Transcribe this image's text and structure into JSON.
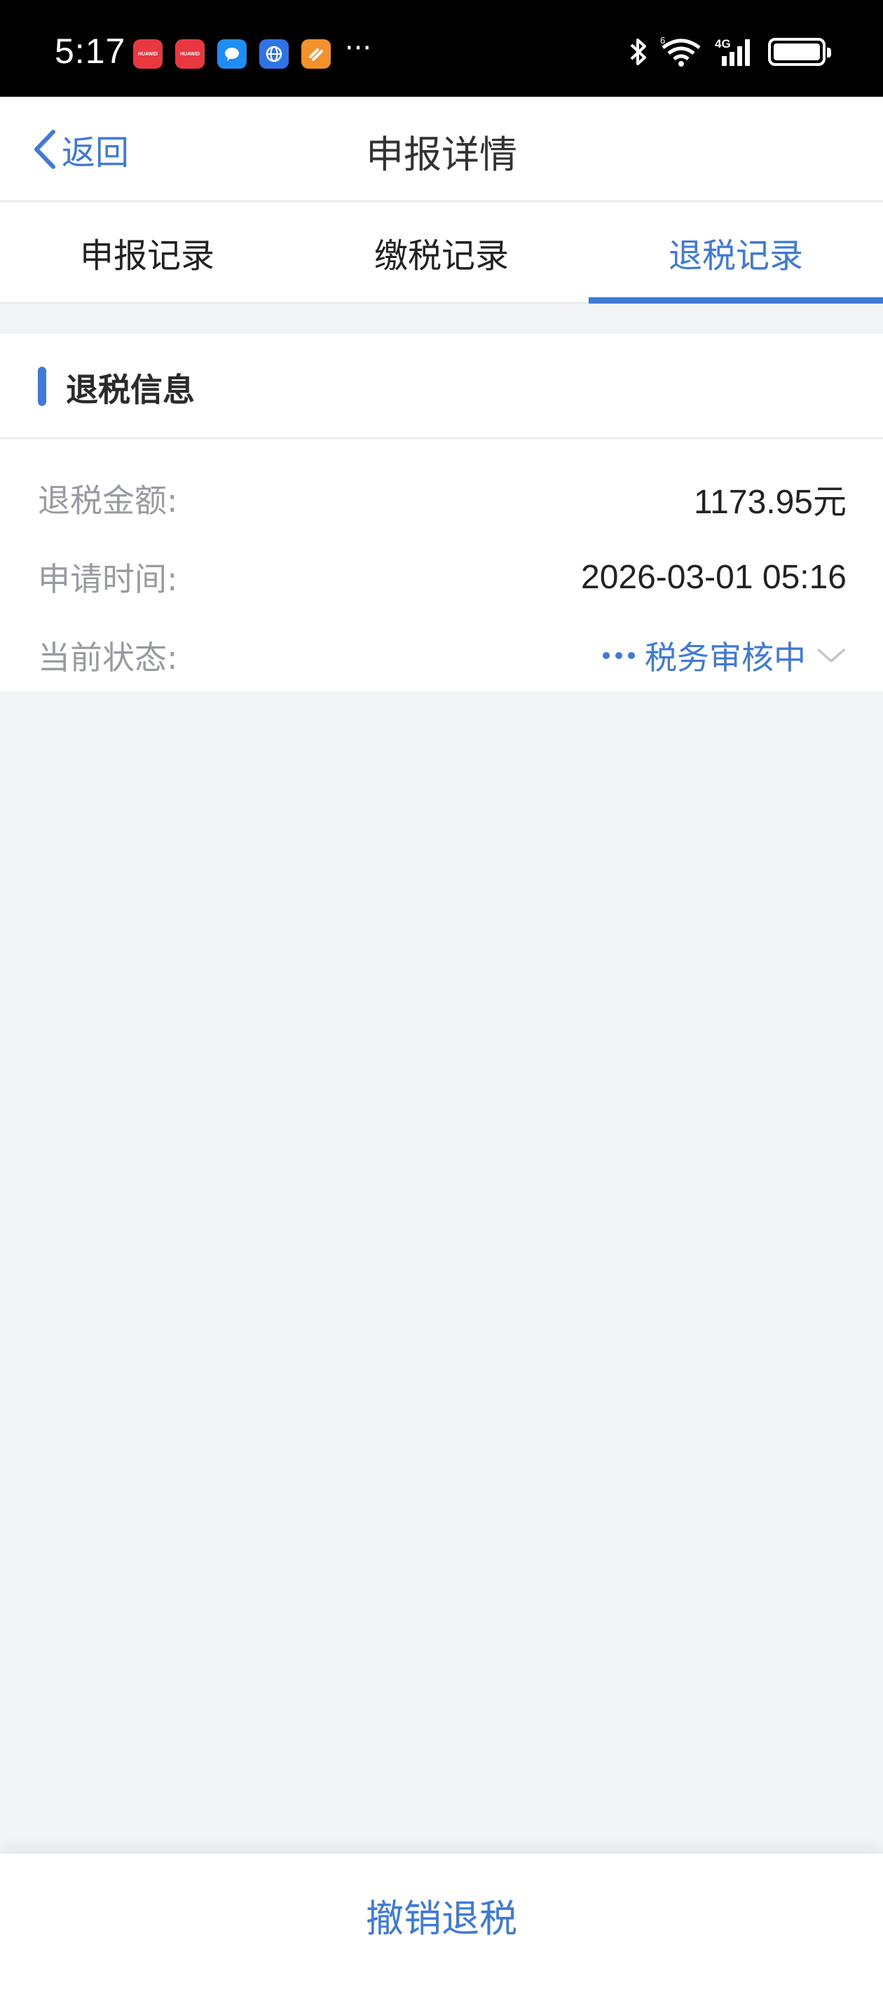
{
  "status_bar": {
    "time": "5:17",
    "more": "···",
    "app_badges": [
      {
        "name": "huawei-store-icon",
        "label": "HUAWEI",
        "color": "#e9383f"
      },
      {
        "name": "huawei-store-icon",
        "label": "HUAWEI",
        "color": "#e9383f"
      },
      {
        "name": "messages-icon",
        "label": "",
        "color": "#1e8ef5"
      },
      {
        "name": "browser-icon",
        "label": "",
        "color": "#2f73e6"
      },
      {
        "name": "orange-app-icon",
        "label": "",
        "color": "#f5912a"
      }
    ],
    "network_label": "4G",
    "wifi_label": "6"
  },
  "nav": {
    "back_label": "返回",
    "title": "申报详情"
  },
  "tabs": [
    {
      "label": "申报记录",
      "active": false
    },
    {
      "label": "缴税记录",
      "active": false
    },
    {
      "label": "退税记录",
      "active": true
    }
  ],
  "refund_info": {
    "section_title": "退税信息",
    "amount_label": "退税金额:",
    "amount_value": "1173.95元",
    "time_label": "申请时间:",
    "time_value": "2026-03-01 05:16",
    "status_label": "当前状态:",
    "status_value": "税务审核中"
  },
  "footer": {
    "revoke_label": "撤销退税"
  },
  "colors": {
    "accent": "#3f7ad9",
    "background": "#f3f4f8",
    "label": "#999ba2"
  }
}
